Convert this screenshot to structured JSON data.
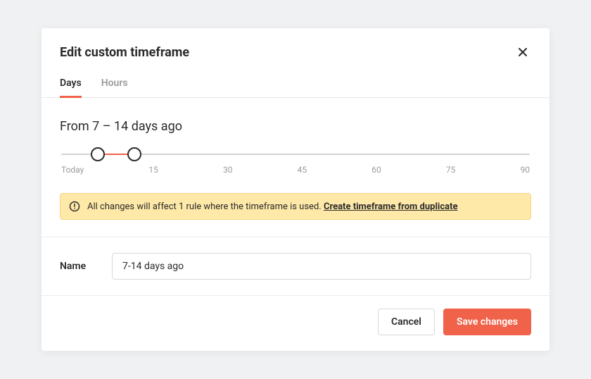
{
  "modal": {
    "title": "Edit custom timeframe"
  },
  "tabs": {
    "days": "Days",
    "hours": "Hours",
    "active": "days"
  },
  "range": {
    "summary": "From 7 – 14 days ago",
    "from": 7,
    "to": 14,
    "ticks": [
      "Today",
      "15",
      "30",
      "45",
      "60",
      "75",
      "90"
    ],
    "min": 0,
    "max": 90
  },
  "alert": {
    "message": "All changes will affect 1 rule where the timeframe is used. ",
    "link": "Create timeframe from duplicate"
  },
  "nameField": {
    "label": "Name",
    "value": "7-14 days ago"
  },
  "buttons": {
    "cancel": "Cancel",
    "save": "Save changes"
  },
  "colors": {
    "accent": "#f1624a",
    "alertBg": "#ffe9a8"
  }
}
